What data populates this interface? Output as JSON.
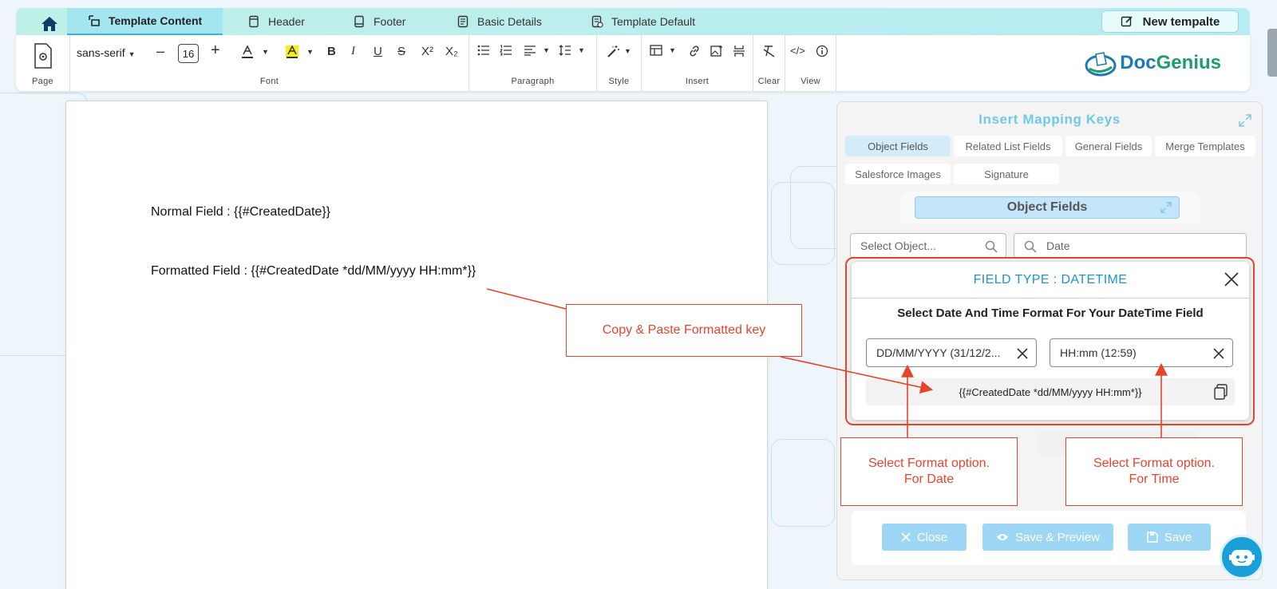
{
  "tabs": {
    "home_icon": "home-icon",
    "items": [
      {
        "label": "Template Content",
        "icon": "template-content-icon"
      },
      {
        "label": "Header",
        "icon": "header-icon"
      },
      {
        "label": "Footer",
        "icon": "footer-icon"
      },
      {
        "label": "Basic Details",
        "icon": "basic-details-icon"
      },
      {
        "label": "Template Default",
        "icon": "template-default-icon"
      }
    ],
    "new_template_label": "New tempalte"
  },
  "toolbar": {
    "groups": [
      "Page",
      "Font",
      "Paragraph",
      "Style",
      "Insert",
      "Clear",
      "View"
    ],
    "font_family": "sans-serif",
    "font_size": "16",
    "minus": "–",
    "plus": "+"
  },
  "logo": {
    "part1": "Doc",
    "part2": "Genius"
  },
  "editor": {
    "line1": "Normal Field : {{#CreatedDate}}",
    "line2": "Formatted Field : {{#CreatedDate *dd/MM/yyyy HH:mm*}}"
  },
  "callouts": {
    "copy": "Copy & Paste Formatted key",
    "date_line1": "Select Format option.",
    "date_line2": "For Date",
    "time_line1": "Select Format option.",
    "time_line2": "For Time"
  },
  "panel": {
    "title": "Insert Mapping Keys",
    "chips": [
      "Object Fields",
      "Related List Fields",
      "General Fields",
      "Merge Templates",
      "Salesforce Images",
      "Signature"
    ],
    "object_fields_label": "Object Fields",
    "select_object_placeholder": "Select Object...",
    "search_value": "Date"
  },
  "modal": {
    "title": "FIELD TYPE : DATETIME",
    "subtitle": "Select Date And Time Format For Your DateTime Field",
    "date_format": "DD/MM/YYYY (31/12/2...",
    "time_format": "HH:mm (12:59)",
    "key": "{{#CreatedDate *dd/MM/yyyy HH:mm*}}"
  },
  "footer": {
    "close": "Close",
    "save_preview": "Save & Preview",
    "save": "Save"
  },
  "colors": {
    "accent": "#1c94d2",
    "callout": "#e8442c",
    "button": "#9ed7f5"
  }
}
